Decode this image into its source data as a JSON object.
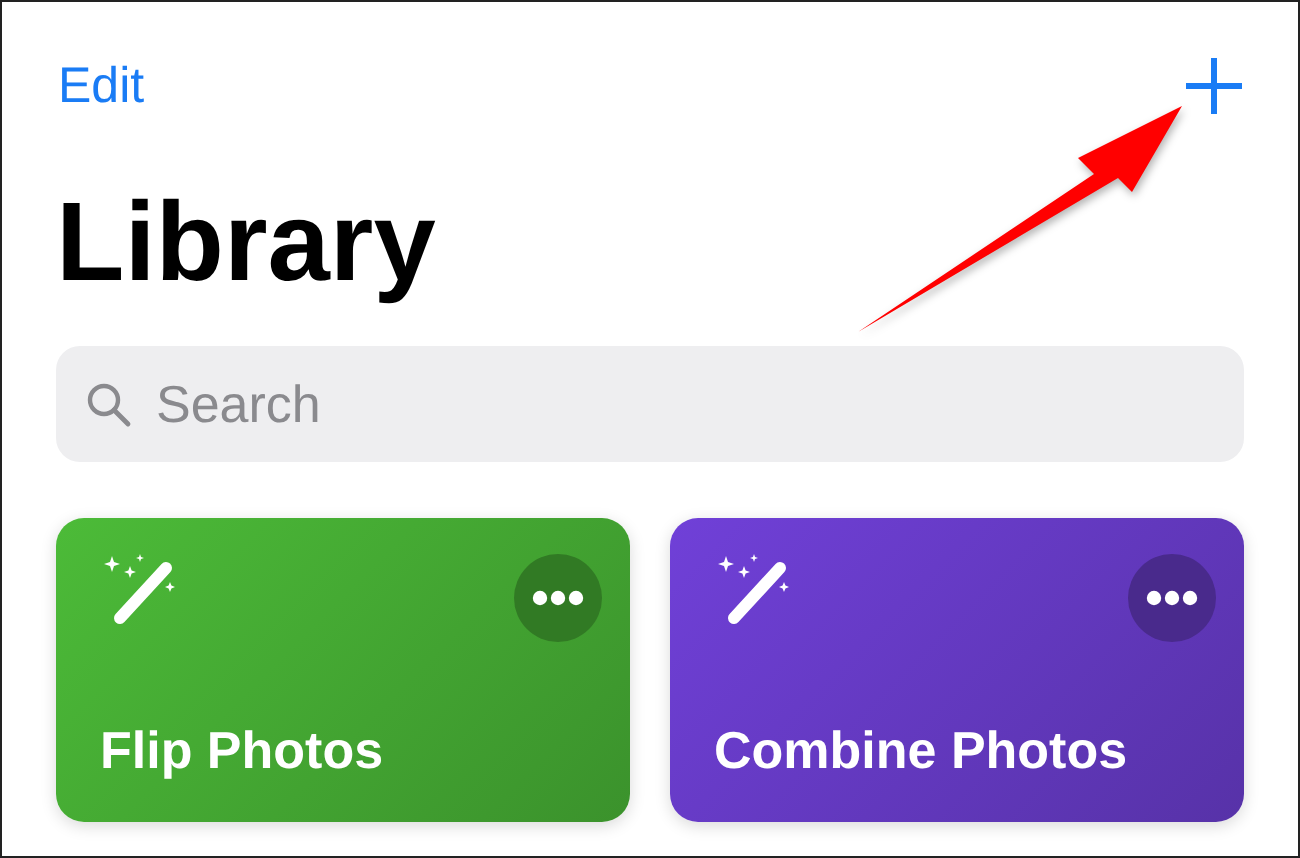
{
  "nav": {
    "edit": "Edit"
  },
  "title": "Library",
  "search": {
    "placeholder": "Search"
  },
  "shortcuts": [
    {
      "name": "Flip Photos",
      "color": "#4cbb38"
    },
    {
      "name": "Combine Photos",
      "color": "#7040d8"
    }
  ]
}
